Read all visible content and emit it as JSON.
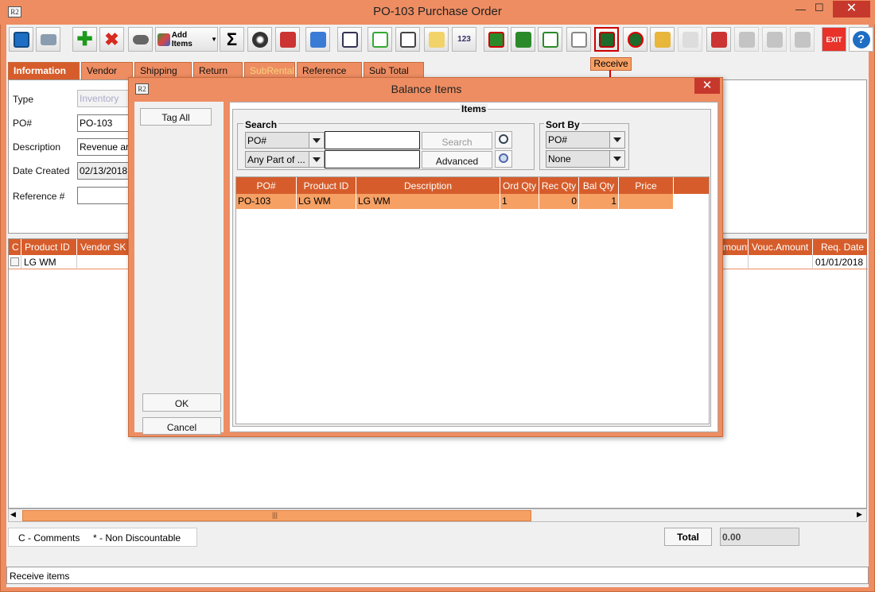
{
  "window": {
    "title": "PO-103 Purchase Order",
    "app_icon": "R2",
    "minimize": "—",
    "restore": "☐",
    "close": "✕"
  },
  "toolbar": {
    "add_items_label": "Add Items",
    "tooltip": "Receive",
    "buttons": [
      "save-icon",
      "print-icon",
      "add-icon",
      "delete-icon",
      "binoculars-icon",
      "add-items-icon",
      "sum-icon",
      "balls-icon",
      "stamp-icon",
      "edit-doc-icon",
      "report-icon",
      "note-icon",
      "form-icon",
      "folder-icon",
      "number-icon",
      "invoice-green-icon",
      "invoice-icon",
      "export-icon",
      "document-icon",
      "receive-icon",
      "no-receive-icon",
      "lock-icon",
      "page-icon",
      "factory-icon",
      "fax-icon",
      "box-icon",
      "grid-icon",
      "exit-icon",
      "help-icon"
    ],
    "exit_label": "EXIT",
    "help_label": "?"
  },
  "tabs": [
    {
      "label": "Information",
      "state": "active"
    },
    {
      "label": "Vendor",
      "state": "normal"
    },
    {
      "label": "Shipping",
      "state": "normal"
    },
    {
      "label": "Return",
      "state": "normal"
    },
    {
      "label": "SubRental",
      "state": "disabled"
    },
    {
      "label": "Reference",
      "state": "normal"
    },
    {
      "label": "Sub Total",
      "state": "normal"
    }
  ],
  "info": {
    "type_label": "Type",
    "type_value": "Inventory",
    "po_label": "PO#",
    "po_value": "PO-103",
    "description_label": "Description",
    "description_value": "Revenue ar",
    "date_label": "Date Created",
    "date_value": "02/13/2018",
    "reference_label": "Reference #",
    "reference_value": ""
  },
  "grid": {
    "headers": {
      "c": "C",
      "product_id": "Product ID",
      "vendor_sku": "Vendor SK",
      "amount": "mount",
      "vouc_amount": "Vouc.Amount",
      "req_date": "Req. Date"
    },
    "rows": [
      {
        "product_id": "LG WM",
        "req_date": "01/01/2018"
      }
    ]
  },
  "scroll": {
    "thumb_label": "|||"
  },
  "footer": {
    "comments_legend": "C - Comments",
    "non_discountable_legend": "* - Non Discountable",
    "total_label": "Total",
    "total_value": "0.00"
  },
  "status": {
    "text": "Receive items"
  },
  "dialog": {
    "title": "Balance Items",
    "tag_all": "Tag All",
    "ok": "OK",
    "cancel": "Cancel",
    "items_title": "Items",
    "search": {
      "title": "Search",
      "field": "PO#",
      "match": "Any Part of ...",
      "value1": "",
      "value2": "",
      "search_button": "Search",
      "advanced_button": "Advanced"
    },
    "sort": {
      "title": "Sort By",
      "primary": "PO#",
      "secondary": "None"
    },
    "columns": [
      "PO#",
      "Product ID",
      "Description",
      "Ord Qty",
      "Rec Qty",
      "Bal Qty",
      "Price"
    ],
    "rows": [
      {
        "po": "PO-103",
        "product_id": "LG WM",
        "description": "LG WM",
        "ord_qty": "1",
        "rec_qty": "0",
        "bal_qty": "1",
        "price": ""
      }
    ]
  }
}
